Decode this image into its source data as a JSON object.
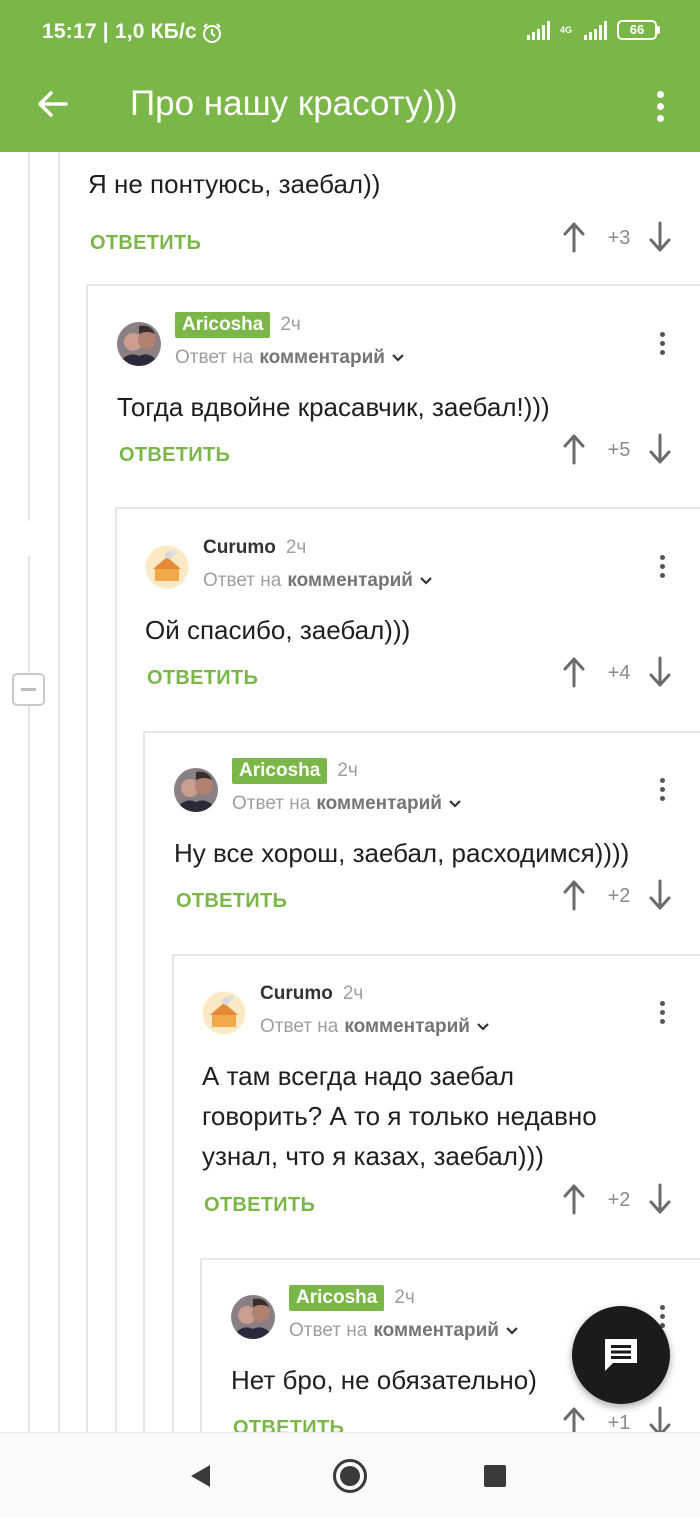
{
  "status_bar": {
    "time": "15:17 | 1,0 КБ/с",
    "network": "4G",
    "battery": "66"
  },
  "toolbar": {
    "title": "Про нашу красоту)))"
  },
  "labels": {
    "reply_to_prefix": "Ответ на",
    "reply_to_target": "комментарий",
    "reply_button": "ОТВЕТИТЬ"
  },
  "comments": [
    {
      "author": "",
      "time": "",
      "text": [
        "Я не понтуюсь, заебал))"
      ],
      "score": "+3"
    },
    {
      "author": "Aricosha",
      "author_is_op": true,
      "time": "2ч",
      "text": [
        "Тогда вдвойне красавчик, заебал!)))"
      ],
      "score": "+5"
    },
    {
      "author": "Curumo",
      "author_is_op": false,
      "time": "2ч",
      "text": [
        "Ой спасибо, заебал)))"
      ],
      "score": "+4"
    },
    {
      "author": "Aricosha",
      "author_is_op": true,
      "time": "2ч",
      "text": [
        "Ну все хорош, заебал, расходимся))))"
      ],
      "score": "+2"
    },
    {
      "author": "Curumo",
      "author_is_op": false,
      "time": "2ч",
      "text": [
        "А там всегда надо заебал",
        "говорить? А то я только недавно",
        "узнал, что я казах, заебал)))"
      ],
      "score": "+2"
    },
    {
      "author": "Aricosha",
      "author_is_op": true,
      "time": "2ч",
      "text": [
        "Нет бро, не обязательно)"
      ],
      "score": "+1"
    }
  ],
  "icons": {
    "back": "arrow-left-icon",
    "menu": "more-vertical-icon",
    "vote_up": "arrow-up-icon",
    "vote_down": "arrow-down-icon",
    "fab": "comment-icon",
    "collapse": "minus-icon"
  },
  "colors": {
    "accent": "#7ab648",
    "fab": "#1b1b1b"
  }
}
